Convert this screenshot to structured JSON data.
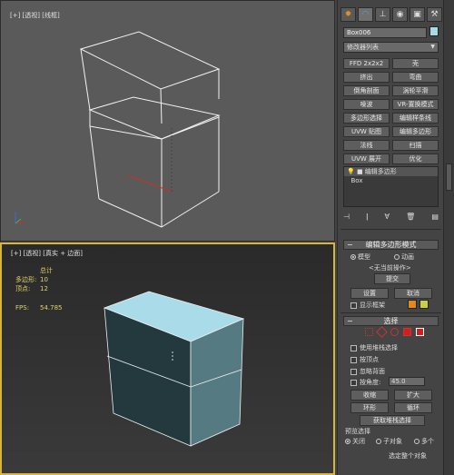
{
  "viewports": {
    "top_label": "[+] [透视] [线框]",
    "persp_label": "[+] [透视] [真实 + 边面]",
    "stats": {
      "header": "总计",
      "polys_label": "多边形:",
      "polys_value": "10",
      "verts_label": "顶点:",
      "verts_value": "12",
      "fps_label": "FPS:",
      "fps_value": "54.785"
    }
  },
  "panel": {
    "tab_icons": [
      "sun-icon",
      "arc-icon",
      "hierarchy-icon",
      "motion-icon",
      "display-icon",
      "utilities-icon"
    ],
    "object_name": "Box006",
    "object_color": "#a8d8ea",
    "modifier_list": "修改器列表",
    "buttons": [
      "FFD 2x2x2",
      "壳",
      "挤出",
      "弯曲",
      "倒角剖面",
      "涡轮平滑",
      "噪波",
      "VR-置换模式",
      "多边形选择",
      "编辑样条线",
      "UVW 贴图",
      "编辑多边形",
      "法线",
      "扫描",
      "UVW 展开",
      "优化"
    ],
    "stack_items": [
      "编辑多边形",
      "Box"
    ],
    "edit_poly": {
      "title": "编辑多边形模式",
      "mode_model": "模型",
      "mode_anim": "动画",
      "no_op": "<无当前操作>",
      "commit": "提交",
      "settings": "设置",
      "cancel": "取消",
      "show_cage": "显示框架",
      "cage_color1": "#e08a1e",
      "cage_color2": "#c8d040"
    },
    "selection": {
      "title": "选择",
      "use_stack": "使用堆栈选择",
      "by_vertex": "按顶点",
      "ignore_back": "忽略背面",
      "by_angle": "按角度:",
      "angle_value": "45.0",
      "shrink": "收缩",
      "grow": "扩大",
      "ring": "环形",
      "loop": "循环",
      "get_stack": "获取堆栈选择",
      "preview_label": "预览选择",
      "preview_off": "关闭",
      "preview_sub": "子对象",
      "preview_multi": "多个",
      "status": "选定整个对象"
    }
  }
}
